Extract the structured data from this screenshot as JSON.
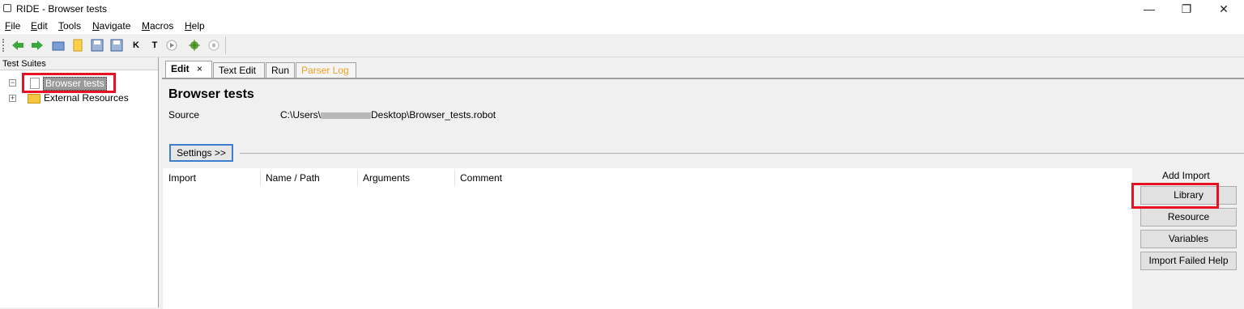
{
  "window": {
    "title": "RIDE - Browser tests",
    "minimize_glyph": "—",
    "maximize_glyph": "❐",
    "close_glyph": "✕"
  },
  "menu": [
    "File",
    "Edit",
    "Tools",
    "Navigate",
    "Macros",
    "Help"
  ],
  "toolbar": {
    "k_label": "K",
    "t_label": "T"
  },
  "tree": {
    "header": "Test Suites",
    "items": [
      {
        "label": "Browser tests",
        "selected": true
      },
      {
        "label": "External Resources",
        "selected": false
      }
    ]
  },
  "tabs": [
    {
      "label": "Edit",
      "active": true,
      "close_glyph": "×"
    },
    {
      "label": "Text Edit"
    },
    {
      "label": "Run"
    },
    {
      "label": "Parser Log",
      "color": "#f0a020"
    }
  ],
  "editor": {
    "suite_name": "Browser tests",
    "source_label": "Source",
    "source_prefix": "C:\\Users\\",
    "source_suffix": "Desktop\\Browser_tests.robot",
    "settings_button": "Settings >>",
    "columns": [
      "Import",
      "Name / Path",
      "Arguments",
      "Comment"
    ]
  },
  "import_panel": {
    "title": "Add Import",
    "buttons": [
      "Library",
      "Resource",
      "Variables",
      "Import Failed Help"
    ]
  },
  "colors": {
    "highlight": "#e81123",
    "settings_focus": "#3c7fcf"
  }
}
